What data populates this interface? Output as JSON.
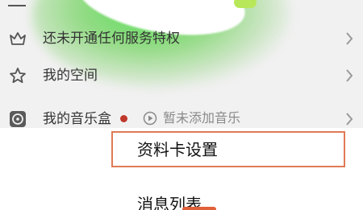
{
  "menu": {
    "vip_label": "还未开通任何服务特权",
    "space_label": "我的空间",
    "music_box_label": "我的音乐盒",
    "music_hint": "暂未添加音乐"
  },
  "sheet": {
    "profile_card_settings": "资料卡设置",
    "message_list": "消息列表"
  },
  "icons": {
    "vip": "crown-icon",
    "space": "star-icon",
    "music_box": "music-disc-icon",
    "play": "play-circle-icon",
    "chevron": "chevron-right-icon"
  },
  "colors": {
    "highlight_border": "#e07a55",
    "notification_dot": "#c0382b",
    "accent_green": "#5fd35a"
  }
}
